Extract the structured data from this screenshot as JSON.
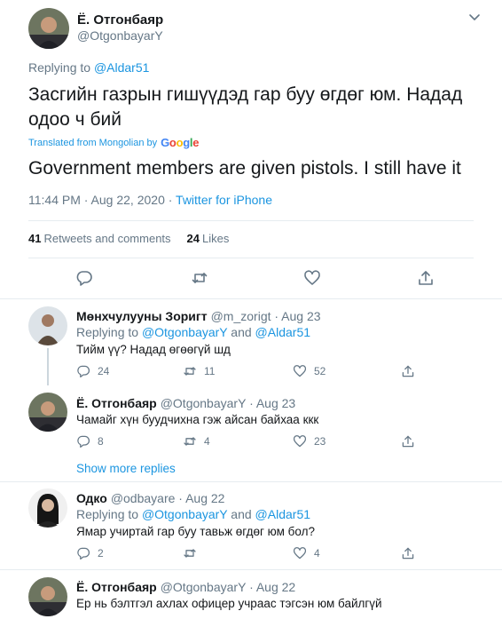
{
  "main_tweet": {
    "author_name": "Ё. Отгонбаяр",
    "author_handle": "@OtgonbayarY",
    "replying_label": "Replying to",
    "replying_to": "@Aldar51",
    "text": "Засгийн газрын гишүүдэд гар буу өгдөг юм. Надад одоо ч бий",
    "translated_label": "Translated from Mongolian by",
    "google_letters": [
      "G",
      "o",
      "o",
      "g",
      "l",
      "e"
    ],
    "translation": "Government members are given pistols. I still have it",
    "time": "11:44 PM · Aug 22, 2020 ·",
    "source": "Twitter for iPhone",
    "retweets_count": "41",
    "retweets_label": "Retweets and comments",
    "likes_count": "24",
    "likes_label": "Likes"
  },
  "replies": [
    {
      "name": "Мөнхчулууны Зоригт",
      "handle": "@m_zorigt",
      "date": "· Aug 23",
      "replying_label": "Replying to",
      "replying_to_1": "@OtgonbayarY",
      "and_label": "and",
      "replying_to_2": "@Aldar51",
      "text": "Тийм үү? Надад өгөөгүй шд",
      "replies_count": "24",
      "retweets_count": "11",
      "likes_count": "52"
    },
    {
      "name": "Ё. Отгонбаяр",
      "handle": "@OtgonbayarY",
      "date": "· Aug 23",
      "text": "Чамайг хүн буудчихна гэж айсан байхаа ккк",
      "replies_count": "8",
      "retweets_count": "4",
      "likes_count": "23"
    },
    {
      "name": "Одко",
      "handle": "@odbayare",
      "date": "· Aug 22",
      "replying_label": "Replying to",
      "replying_to_1": "@OtgonbayarY",
      "and_label": "and",
      "replying_to_2": "@Aldar51",
      "text": "Ямар учиртай гар буу тавьж өгдөг юм бол?",
      "replies_count": "2",
      "retweets_count": "",
      "likes_count": "4"
    },
    {
      "name": "Ё. Отгонбаяр",
      "handle": "@OtgonbayarY",
      "date": "· Aug 22",
      "text": "Ер нь бэлтгэл ахлах офицер учраас тэгсэн юм байлгүй"
    }
  ],
  "show_more_label": "Show more replies",
  "colors": {
    "link": "#1b95e0",
    "muted": "#657786",
    "divider": "#e6ecf0"
  }
}
